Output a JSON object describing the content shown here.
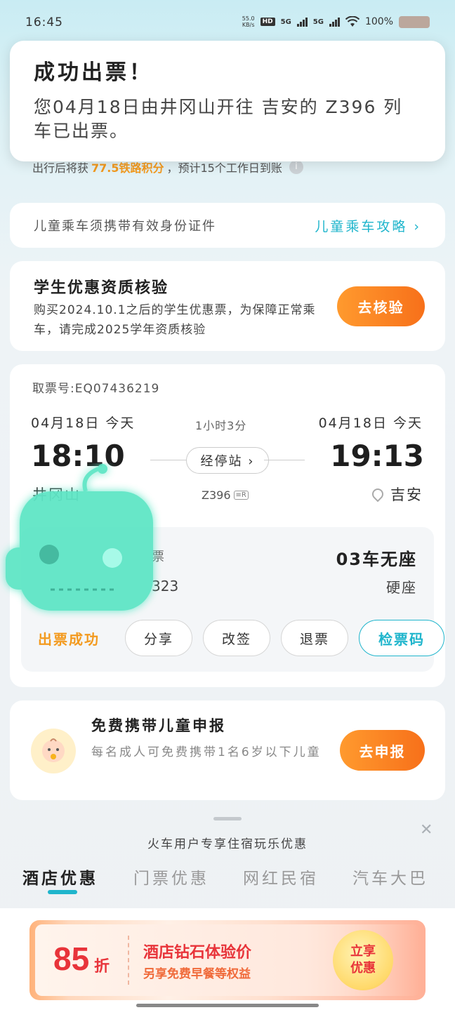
{
  "status_bar": {
    "time": "16:45",
    "net_speed": "55.0",
    "net_unit": "KB/s",
    "hd": "HD",
    "sim1": "5G",
    "sim2": "5G",
    "battery": "100%"
  },
  "notification": {
    "title": "成功出票！",
    "body": "您04月18日由井冈山开往 吉安的 Z396 列车已出票。"
  },
  "points": {
    "prefix": "出行后将获",
    "highlight": "77.5铁路积分",
    "suffix": "，预计15个工作日到账"
  },
  "child_notice": {
    "text": "儿童乘车须携带有效身份证件",
    "link": "儿童乘车攻略 ›"
  },
  "student": {
    "title": "学生优惠资质核验",
    "desc": "购买2024.10.1之后的学生优惠票，为保障正常乘车，请完成2025学年资质核验",
    "button": "去核验"
  },
  "ticket": {
    "ticket_no": "取票号:EQ07436219",
    "dep_date": "04月18日 今天",
    "arr_date": "04月18日 今天",
    "duration": "1小时3分",
    "dep_time": "18:10",
    "arr_time": "19:13",
    "stops_button": "经停站 ›",
    "dep_station": "井冈山",
    "train_no": "Z396",
    "train_tag": "≡R",
    "arr_station": "吉安",
    "ticket_type": "票",
    "coach_seat": "03车无座",
    "id_no": "323",
    "seat_class": "硬座",
    "status": "出票成功",
    "actions": {
      "share": "分享",
      "change": "改签",
      "refund": "退票",
      "check": "检票码"
    }
  },
  "free_child": {
    "title": "免费携带儿童申报",
    "desc": "每名成人可免费携带1名6岁以下儿童",
    "button": "去申报"
  },
  "promo": {
    "title": "火车用户专享住宿玩乐优惠",
    "tabs": [
      "酒店优惠",
      "门票优惠",
      "网红民宿",
      "汽车大巴"
    ],
    "active_tab": 0,
    "banner": {
      "discount": "85",
      "unit": "折",
      "title": "酒店钻石体验价",
      "subtitle": "另享免费早餐等权益",
      "cta": "立享优惠"
    }
  },
  "colors": {
    "accent_teal": "#1fb5cc",
    "accent_orange": "#f7701a",
    "status_orange": "#f39a1e",
    "promo_red": "#e8343a"
  }
}
